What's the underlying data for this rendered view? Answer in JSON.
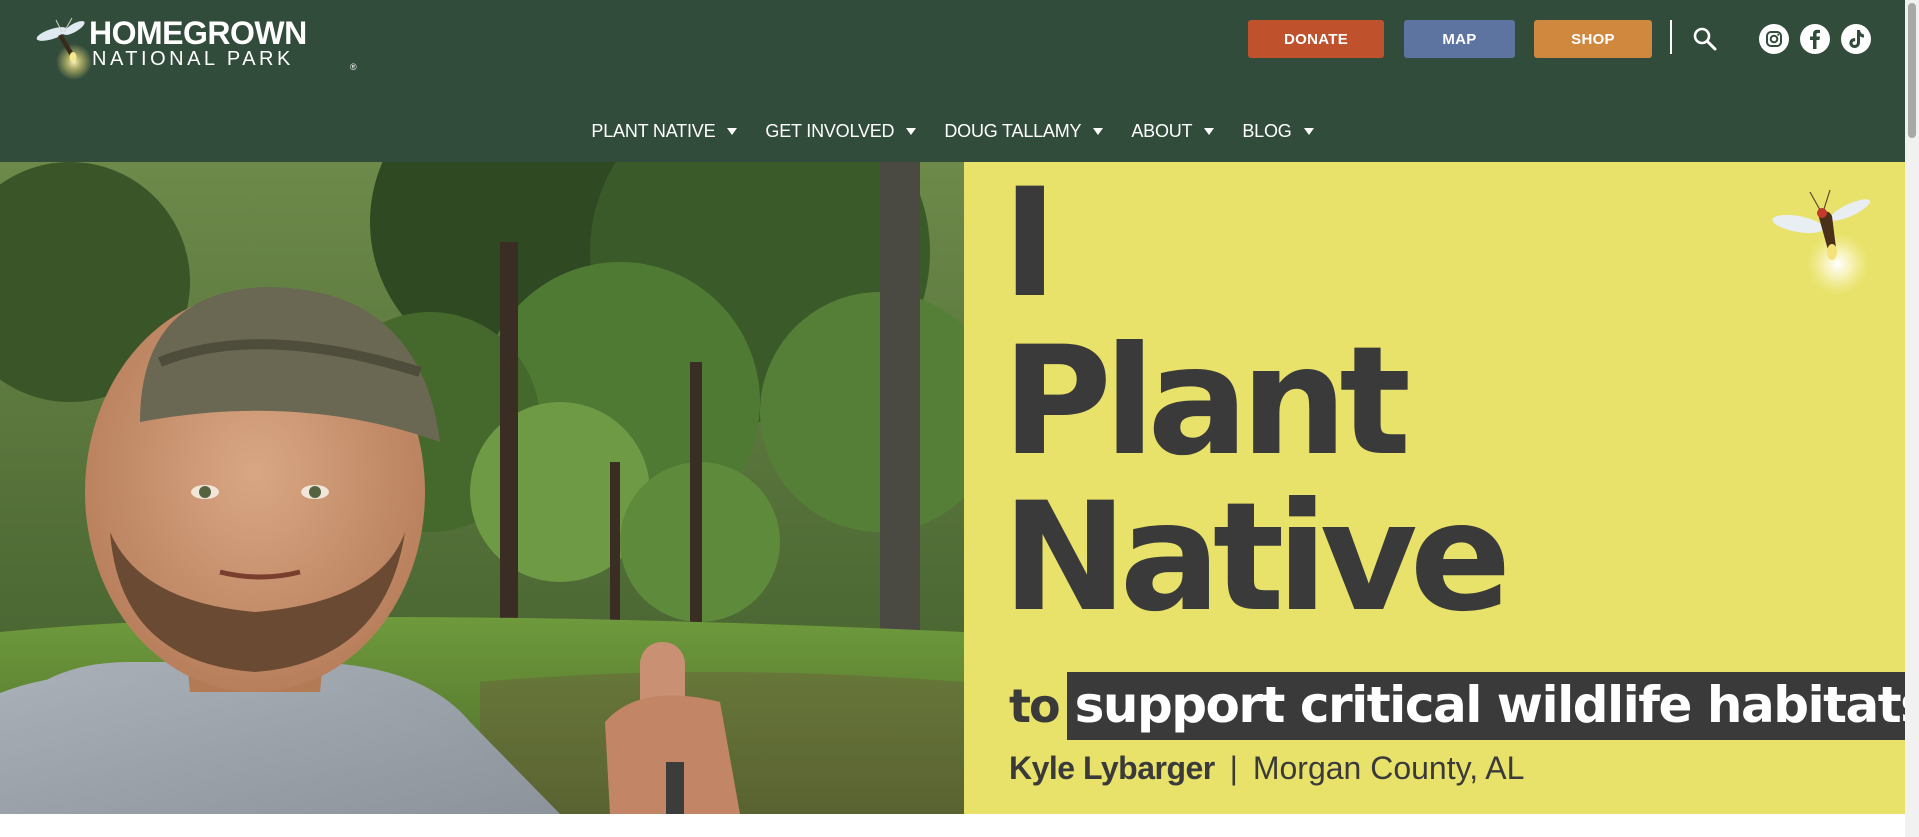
{
  "header": {
    "logo": {
      "line1": "HOMEGROWN",
      "line2": "NATIONAL PARK",
      "registered": "®"
    },
    "buttons": {
      "donate": "DONATE",
      "map": "MAP",
      "shop": "SHOP"
    },
    "search_icon": "search-icon",
    "social": [
      "instagram-icon",
      "facebook-icon",
      "tiktok-icon"
    ],
    "nav": [
      {
        "label": "PLANT NATIVE"
      },
      {
        "label": "GET INVOLVED"
      },
      {
        "label": "DOUG TALLAMY"
      },
      {
        "label": "ABOUT"
      },
      {
        "label": "BLOG"
      }
    ]
  },
  "hero": {
    "headline": [
      "I",
      "Plant",
      "Native"
    ],
    "tagline_prefix": "to",
    "tagline": "support critical wildlife habitats",
    "credit_name": "Kyle Lybarger",
    "credit_separator": "|",
    "credit_location": "Morgan County, AL"
  },
  "colors": {
    "header_bg": "#324c3c",
    "donate": "#c0512d",
    "map": "#5d74a0",
    "shop": "#d0883f",
    "hero_panel": "#e8e26a",
    "headline_text": "#3a3a3a"
  }
}
